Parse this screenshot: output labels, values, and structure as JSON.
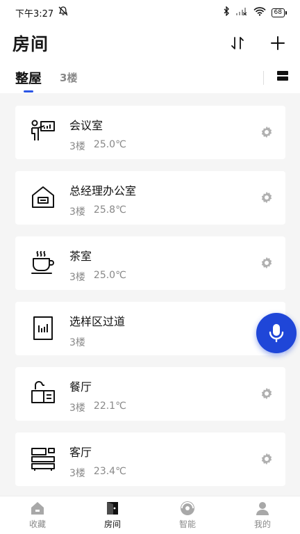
{
  "status_bar": {
    "time": "下午3:27",
    "battery": "68"
  },
  "header": {
    "title": "房间"
  },
  "tabs": [
    {
      "label": "整屋",
      "active": true
    },
    {
      "label": "3楼",
      "active": false
    }
  ],
  "rooms": [
    {
      "name": "会议室",
      "floor": "3楼",
      "temp": "25.0℃",
      "icon": "presentation-icon"
    },
    {
      "name": "总经理办公室",
      "floor": "3楼",
      "temp": "25.8℃",
      "icon": "house-icon"
    },
    {
      "name": "茶室",
      "floor": "3楼",
      "temp": "25.0℃",
      "icon": "tea-cup-icon"
    },
    {
      "name": "选样区过道",
      "floor": "3楼",
      "temp": "",
      "icon": "corridor-icon"
    },
    {
      "name": "餐厅",
      "floor": "3楼",
      "temp": "22.1℃",
      "icon": "dining-icon"
    },
    {
      "name": "客厅",
      "floor": "3楼",
      "temp": "23.4℃",
      "icon": "sofa-icon"
    }
  ],
  "bottom_nav": [
    {
      "label": "收藏",
      "icon": "home-icon",
      "active": false
    },
    {
      "label": "房间",
      "icon": "door-icon",
      "active": true
    },
    {
      "label": "智能",
      "icon": "smart-icon",
      "active": false
    },
    {
      "label": "我的",
      "icon": "profile-icon",
      "active": false
    }
  ],
  "colors": {
    "accent": "#2a55e5",
    "fab": "#1f46d8"
  }
}
